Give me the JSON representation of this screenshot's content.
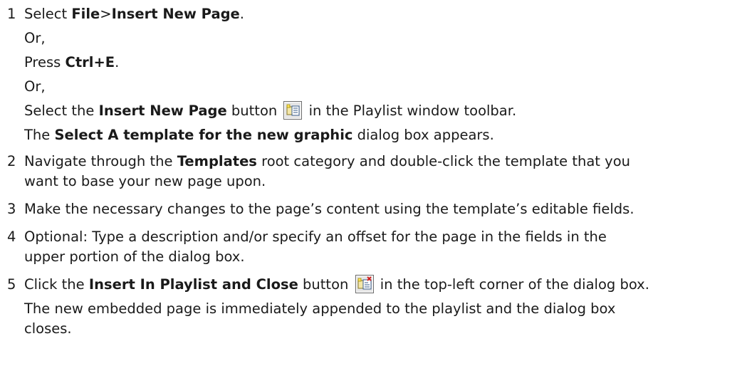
{
  "steps": [
    {
      "num": "1",
      "line1": {
        "pre": "Select ",
        "bold1": "File",
        "mid": ">",
        "bold2": "Insert New Page",
        "post": "."
      },
      "or1": "Or,",
      "line2": {
        "pre": "Press ",
        "bold": "Ctrl+E",
        "post": "."
      },
      "or2": "Or,",
      "line3": {
        "pre": "Select the ",
        "bold": "Insert New Page",
        "mid": " button ",
        "post": " in the Playlist window toolbar."
      },
      "line4": {
        "pre": "The ",
        "bold": "Select A template for the new graphic",
        "post": " dialog box appears."
      }
    },
    {
      "num": "2",
      "line1": {
        "pre": "Navigate through the ",
        "bold": "Templates",
        "post": " root category and double-click the template that you"
      },
      "line2": "want to base your new page upon."
    },
    {
      "num": "3",
      "line1": "Make the necessary changes to the page’s content using the template’s editable fields."
    },
    {
      "num": "4",
      "line1": "Optional: Type a description and/or specify an offset for the page in the fields in the",
      "line2": "upper portion of the dialog box."
    },
    {
      "num": "5",
      "line1": {
        "pre": "Click the ",
        "bold": "Insert In Playlist and Close",
        "mid": " button ",
        "post": " in the top-left corner of the dialog box."
      },
      "line2": "The new embedded page is immediately appended to the playlist and the dialog box",
      "line3": "closes."
    }
  ],
  "icons": {
    "insert_new_page": "insert-new-page-icon",
    "insert_in_playlist_close": "insert-in-playlist-and-close-icon"
  }
}
